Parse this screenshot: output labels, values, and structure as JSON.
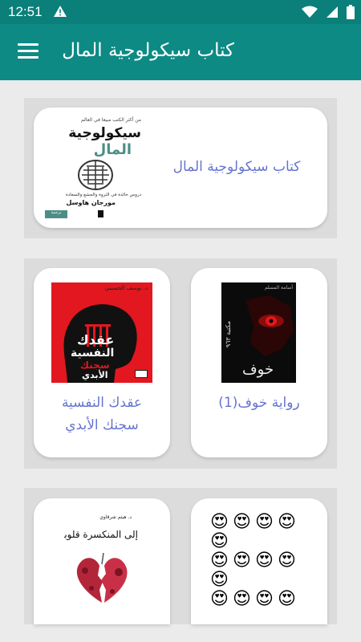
{
  "status": {
    "time": "12:51"
  },
  "appbar": {
    "title": "كتاب سيكولوجية المال"
  },
  "books": {
    "featured": {
      "title": "كتاب سيكولوجية المال",
      "cover": {
        "top_line": "من أكثر الكتب مبيعا في العالم",
        "title_a": "سيكولوجية",
        "title_b": "المال",
        "tagline": "دروس خالدة في الثروة والجشع والسعادة",
        "author": "مورجان هاوسل",
        "translator": "ترجمة"
      }
    },
    "left1": {
      "title": "عقدك النفسية سجنك الأبدي",
      "cover": {
        "author": "د. يوسف الحسيني",
        "t1": "عقدك",
        "t2": "النفسية",
        "t3": "سجنك",
        "t4": "الأبدي"
      }
    },
    "right1": {
      "title": "رواية خوف(1)",
      "cover": {
        "author": "أسامة المسلم",
        "publisher": "مكتبة ٩٦٣",
        "word": "خوف"
      }
    },
    "left2": {
      "cover": {
        "author": "د. هيثم شرقاوي",
        "title": "إلى المنكسرة قلوبهم"
      }
    },
    "right2": {
      "cover": {
        "emoji": "😍"
      }
    }
  }
}
